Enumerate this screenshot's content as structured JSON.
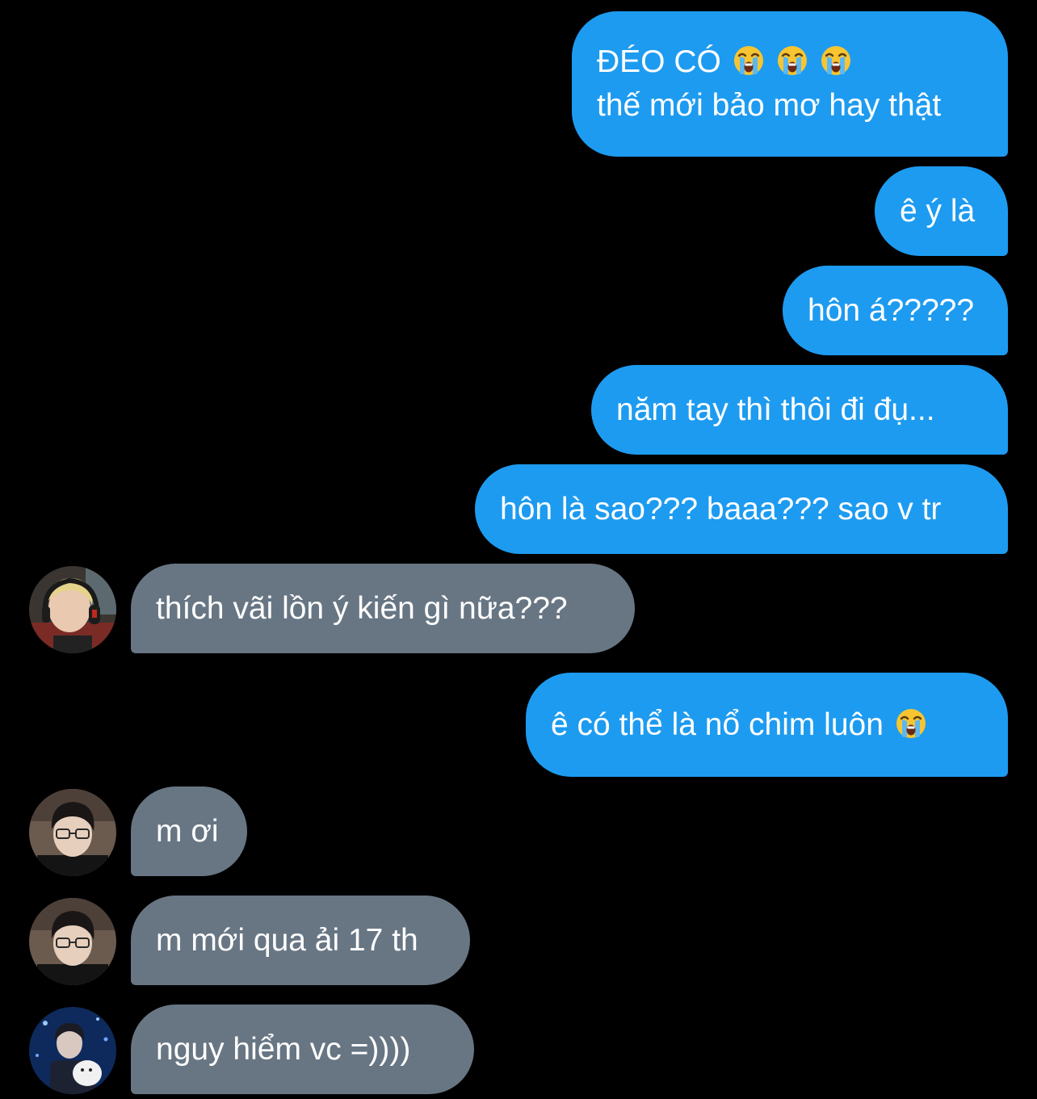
{
  "colors": {
    "background": "#000000",
    "sent_bubble": "#1d9bf0",
    "received_bubble": "#687684",
    "text": "#ffffff"
  },
  "messages": [
    {
      "direction": "sent",
      "lines": [
        "ĐÉO CÓ",
        "thế mới bảo mơ hay thật"
      ],
      "emojis_line0": [
        "loudly-crying-face",
        "loudly-crying-face",
        "loudly-crying-face"
      ]
    },
    {
      "direction": "sent",
      "text": "ê ý là"
    },
    {
      "direction": "sent",
      "text": "hôn á?????"
    },
    {
      "direction": "sent",
      "text": "năm tay thì thôi đi đụ..."
    },
    {
      "direction": "sent",
      "text": "hôn là sao??? baaa??? sao v tr"
    },
    {
      "direction": "received",
      "text": "thích vãi lồn ý kiến gì nữa???",
      "avatar": "avatar-blonde-headset"
    },
    {
      "direction": "sent",
      "text": "ê có thể là nổ chim luôn",
      "emojis": [
        "loudly-crying-face"
      ]
    },
    {
      "direction": "received",
      "text": "m ơi",
      "avatar": "avatar-glasses"
    },
    {
      "direction": "received",
      "text": "m mới qua ải 17 th",
      "avatar": "avatar-glasses"
    },
    {
      "direction": "received",
      "text": "nguy hiểm vc =))))",
      "avatar": "avatar-blue-night"
    }
  ]
}
